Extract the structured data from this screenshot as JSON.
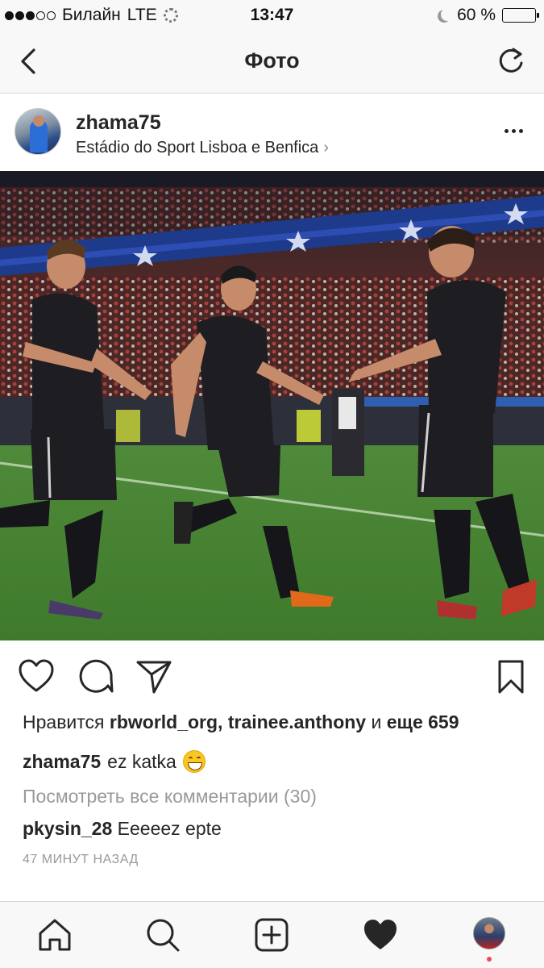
{
  "status_bar": {
    "carrier": "Билайн",
    "network": "LTE",
    "time": "13:47",
    "battery": "60 %",
    "battery_level": 0.6,
    "signal_bars_filled": 3,
    "signal_bars_total": 5
  },
  "nav": {
    "title": "Фото",
    "back_icon": "chevron-left-icon",
    "refresh_icon": "refresh-icon"
  },
  "post": {
    "username": "zhama75",
    "location": "Estádio do Sport Lisboa e Benfica",
    "location_chevron": "›",
    "more_icon": "ellipsis-icon",
    "likes_prefix": "Нравится ",
    "likes_users": "rbworld_org, trainee.anthony",
    "likes_and": " и ",
    "likes_more": "еще 659",
    "caption_user": "zhama75",
    "caption_text": "ez katka",
    "caption_emoji": "grinning-face-emoji",
    "view_comments": "Посмотреть все комментарии (30)",
    "comment_user": "pkysin_28",
    "comment_text": "Eeeeez epte",
    "timestamp": "47 МИНУТ НАЗАД"
  },
  "actions": [
    "heart-icon",
    "comment-icon",
    "share-icon",
    "bookmark-icon"
  ],
  "tabs": [
    "home-icon",
    "search-icon",
    "add-icon",
    "activity-icon",
    "profile-avatar"
  ],
  "colors": {
    "bar_background": "#f8f8f8",
    "text": "#262626",
    "muted": "#999999",
    "battery": "#f5c000",
    "notification": "#ed4956"
  }
}
